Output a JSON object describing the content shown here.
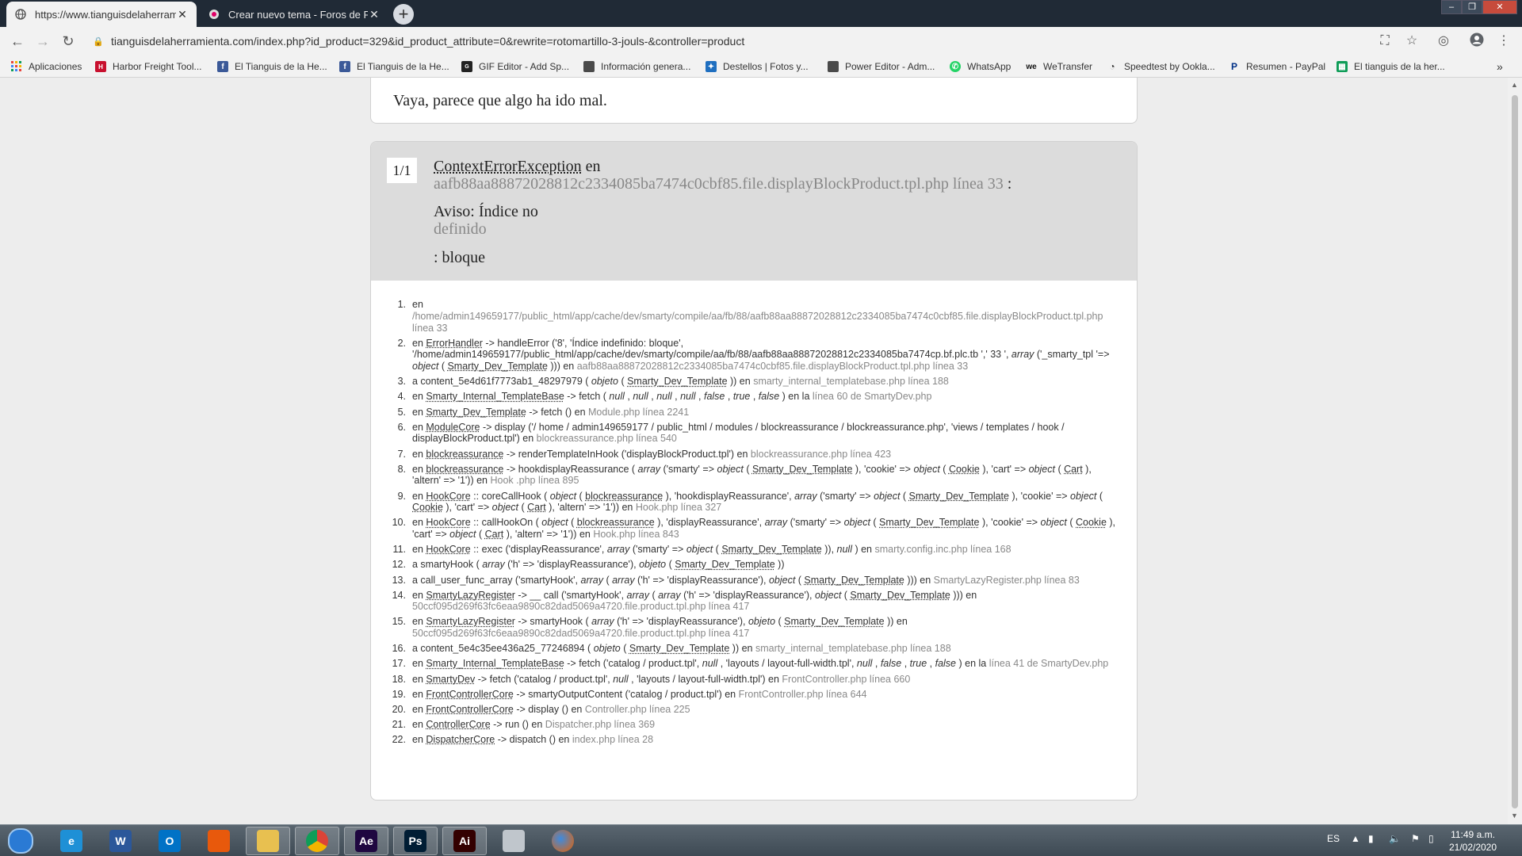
{
  "browser": {
    "tabs": [
      {
        "title": "https://www.tianguisdelaherramienta",
        "active": true
      },
      {
        "title": "Crear nuevo tema - Foros de Pre",
        "active": false
      }
    ],
    "url": "tianguisdelaherramienta.com/index.php?id_product=329&id_product_attribute=0&rewrite=rotomartillo-3-jouls-&controller=product",
    "bookmarks": [
      {
        "label": "Aplicaciones",
        "icon": "apps-icon"
      },
      {
        "label": "Harbor Freight Tool...",
        "icon": "harbor-freight-icon"
      },
      {
        "label": "El Tianguis de la He...",
        "icon": "facebook-icon"
      },
      {
        "label": "El Tianguis de la He...",
        "icon": "facebook-icon"
      },
      {
        "label": "GIF Editor - Add Sp...",
        "icon": "gif-editor-icon"
      },
      {
        "label": "Información genera...",
        "icon": "page-icon"
      },
      {
        "label": "Destellos | Fotos y...",
        "icon": "destellos-icon"
      },
      {
        "label": "Power Editor - Adm...",
        "icon": "page-icon"
      },
      {
        "label": "WhatsApp",
        "icon": "whatsapp-icon"
      },
      {
        "label": "WeTransfer",
        "icon": "wetransfer-icon"
      },
      {
        "label": "Speedtest by Ookla...",
        "icon": "speedtest-icon"
      },
      {
        "label": "Resumen - PayPal",
        "icon": "paypal-icon"
      },
      {
        "label": "El tianguis de la her...",
        "icon": "sheets-icon"
      }
    ]
  },
  "page": {
    "error_message": "Vaya, parece que algo ha ido mal.",
    "counter": "1/1",
    "exception_class": "ContextErrorException",
    "en": "en",
    "exception_file": "aafb88aa88872028812c2334085ba7474c0cbf85.file.displayBlockProduct.tpl.php línea 33",
    "colon": ":",
    "notice_label": "Aviso: Índice no",
    "notice_undefined": "definido",
    "block": ": bloque"
  },
  "stack_trace": [
    {
      "num": "1.",
      "html": "en <span class=\"file\">/home/admin149659177/public_html/app/cache/dev/smarty/compile/aa/fb/88/aafb88aa88872028812c2334085ba7474c0cbf85.file.displayBlockProduct.tpl.php línea 33</span>"
    },
    {
      "num": "2.",
      "html": "en <span class=\"cls\">ErrorHandler</span> -> handleError ('8', 'Índice indefinido: bloque', '/home/admin149659177/public_html/app/cache/dev/smarty/compile/aa/fb/88/aafb88aa88872028812c2334085ba7474cp.bf.plc.tb ',' 33 ', <i>array</i> ('_smarty_tpl '=> <i>object</i> ( <span class=\"cls\">Smarty_Dev_Template</span> ))) en <span class=\"file\">aafb88aa88872028812c2334085ba7474c0cbf85.file.displayBlockProduct.tpl.php línea 33</span>"
    },
    {
      "num": "3.",
      "html": "a content_5e4d61f7773ab1_48297979 ( <i>objeto</i> ( <span class=\"cls\">Smarty_Dev_Template</span> )) en <span class=\"file\">smarty_internal_templatebase.php línea 188</span>"
    },
    {
      "num": "4.",
      "html": "en <span class=\"cls\">Smarty_Internal_TemplateBase</span> -> fetch ( <i>null</i> , <i>null</i> , <i>null</i> , <i>null</i> , <i>false</i> , <i>true</i> , <i>false</i> ) en la <span class=\"file\">línea 60 de SmartyDev.php</span>"
    },
    {
      "num": "5.",
      "html": "en <span class=\"cls\">Smarty_Dev_Template</span> -> fetch () en <span class=\"file\">Module.php línea 2241</span>"
    },
    {
      "num": "6.",
      "html": "en <span class=\"cls\">ModuleCore</span> -> display ('/ home / admin149659177 / public_html / modules / blockreassurance / blockreassurance.php', 'views / templates / hook / displayBlockProduct.tpl') en <span class=\"file\">blockreassurance.php línea 540</span>"
    },
    {
      "num": "7.",
      "html": "en <span class=\"cls\">blockreassurance</span> -> renderTemplateInHook ('displayBlockProduct.tpl') en <span class=\"file\">blockreassurance.php línea 423</span>"
    },
    {
      "num": "8.",
      "html": "en <span class=\"cls\">blockreassurance</span> -> hookdisplayReassurance ( <i>array</i> ('smarty' => <i>object</i> ( <span class=\"cls\">Smarty_Dev_Template</span> ), 'cookie' => <i>object</i> ( <span class=\"cls\">Cookie</span> ), 'cart' => <i>object</i> ( <span class=\"cls\">Cart</span> ), 'altern' => '1')) en <span class=\"file\">Hook .php línea 895</span>"
    },
    {
      "num": "9.",
      "html": "en <span class=\"cls\">HookCore</span> :: coreCallHook ( <i>object</i> ( <span class=\"cls\">blockreassurance</span> ), 'hookdisplayReassurance', <i>array</i> ('smarty' => <i>object</i> ( <span class=\"cls\">Smarty_Dev_Template</span> ), 'cookie' => <i>object</i> ( <span class=\"cls\">Cookie</span> ), 'cart' => <i>object</i> ( <span class=\"cls\">Cart</span> ), 'altern' => '1')) en <span class=\"file\">Hook.php línea 327</span>"
    },
    {
      "num": "10.",
      "html": "en <span class=\"cls\">HookCore</span> :: callHookOn ( <i>object</i> ( <span class=\"cls\">blockreassurance</span> ), 'displayReassurance', <i>array</i> ('smarty' => <i>object</i> ( <span class=\"cls\">Smarty_Dev_Template</span> ), 'cookie' => <i>object</i> ( <span class=\"cls\">Cookie</span> ), 'cart' => <i>object</i> ( <span class=\"cls\">Cart</span> ), 'altern' => '1')) en <span class=\"file\">Hook.php línea 843</span>"
    },
    {
      "num": "11.",
      "html": "en <span class=\"cls\">HookCore</span> :: exec ('displayReassurance', <i>array</i> ('smarty' => <i>object</i> ( <span class=\"cls\">Smarty_Dev_Template</span> )), <i>null</i> ) en <span class=\"file\">smarty.config.inc.php línea 168</span>"
    },
    {
      "num": "12.",
      "html": "a smartyHook ( <i>array</i> ('h' => 'displayReassurance'), <i>objeto</i> ( <span class=\"cls\">Smarty_Dev_Template</span> ))"
    },
    {
      "num": "13.",
      "html": "a call_user_func_array ('smartyHook', <i>array</i> ( <i>array</i> ('h' => 'displayReassurance'), <i>object</i> ( <span class=\"cls\">Smarty_Dev_Template</span> ))) en <span class=\"file\">SmartyLazyRegister.php línea 83</span>"
    },
    {
      "num": "14.",
      "html": "en <span class=\"cls\">SmartyLazyRegister</span> -> __ call ('smartyHook', <i>array</i> ( <i>array</i> ('h' => 'displayReassurance'), <i>object</i> ( <span class=\"cls\">Smarty_Dev_Template</span> ))) en <span class=\"file\">50ccf095d269f63fc6eaa9890c82dad5069a4720.file.product.tpl.php línea 417</span>"
    },
    {
      "num": "15.",
      "html": "en <span class=\"cls\">SmartyLazyRegister</span> -> smartyHook ( <i>array</i> ('h' => 'displayReassurance'), <i>objeto</i> ( <span class=\"cls\">Smarty_Dev_Template</span> )) en <span class=\"file\">50ccf095d269f63fc6eaa9890c82dad5069a4720.file.product.tpl.php línea 417</span>"
    },
    {
      "num": "16.",
      "html": "a content_5e4c35ee436a25_77246894 ( <i>objeto</i> ( <span class=\"cls\">Smarty_Dev_Template</span> )) en <span class=\"file\">smarty_internal_templatebase.php línea 188</span>"
    },
    {
      "num": "17.",
      "html": "en <span class=\"cls\">Smarty_Internal_TemplateBase</span> -> fetch ('catalog / product.tpl', <i>null</i> , 'layouts / layout-full-width.tpl', <i>null</i> , <i>false</i> , <i>true</i> , <i>false</i> ) en la <span class=\"file\">línea 41 de SmartyDev.php</span>"
    },
    {
      "num": "18.",
      "html": "en <span class=\"cls\">SmartyDev</span> -> fetch ('catalog / product.tpl', <i>null</i> , 'layouts / layout-full-width.tpl') en <span class=\"file\">FrontController.php línea 660</span>"
    },
    {
      "num": "19.",
      "html": "en <span class=\"cls\">FrontControllerCore</span> -> smartyOutputContent ('catalog / product.tpl') en <span class=\"file\">FrontController.php línea 644</span>"
    },
    {
      "num": "20.",
      "html": "en <span class=\"cls\">FrontControllerCore</span> -> display () en <span class=\"file\">Controller.php línea 225</span>"
    },
    {
      "num": "21.",
      "html": "en <span class=\"cls\">ControllerCore</span> -> run () en <span class=\"file\">Dispatcher.php línea 369</span>"
    },
    {
      "num": "22.",
      "html": "en <span class=\"cls\">DispatcherCore</span> -> dispatch () en <span class=\"file\">index.php línea 28</span>"
    }
  ],
  "taskbar": {
    "apps": [
      {
        "name": "start-button",
        "icon": "windows-orb-icon",
        "label": "",
        "color": "#2a7ad4"
      },
      {
        "name": "internet-explorer",
        "icon": "ie-icon",
        "label": "e",
        "color": "#1e90d6"
      },
      {
        "name": "word",
        "icon": "word-icon",
        "label": "W",
        "color": "#2b579a"
      },
      {
        "name": "outlook",
        "icon": "outlook-icon",
        "label": "O",
        "color": "#0072c6"
      },
      {
        "name": "office",
        "icon": "office-icon",
        "label": "",
        "color": "#e8590c"
      },
      {
        "name": "explorer",
        "icon": "folder-icon",
        "label": "",
        "color": "#e8c050"
      },
      {
        "name": "chrome",
        "icon": "chrome-icon",
        "label": "",
        "color": "#db4437"
      },
      {
        "name": "after-effects",
        "icon": "after-effects-icon",
        "label": "Ae",
        "color": "#1f0740"
      },
      {
        "name": "photoshop",
        "icon": "photoshop-icon",
        "label": "Ps",
        "color": "#001d34"
      },
      {
        "name": "illustrator",
        "icon": "illustrator-icon",
        "label": "Ai",
        "color": "#330000"
      },
      {
        "name": "paint",
        "icon": "paint-icon",
        "label": "",
        "color": "#c0c6cc"
      },
      {
        "name": "firefox",
        "icon": "firefox-icon",
        "label": "",
        "color": "#2f6fd0"
      }
    ],
    "language": "ES",
    "time": "11:49 a.m.",
    "date": "21/02/2020"
  }
}
